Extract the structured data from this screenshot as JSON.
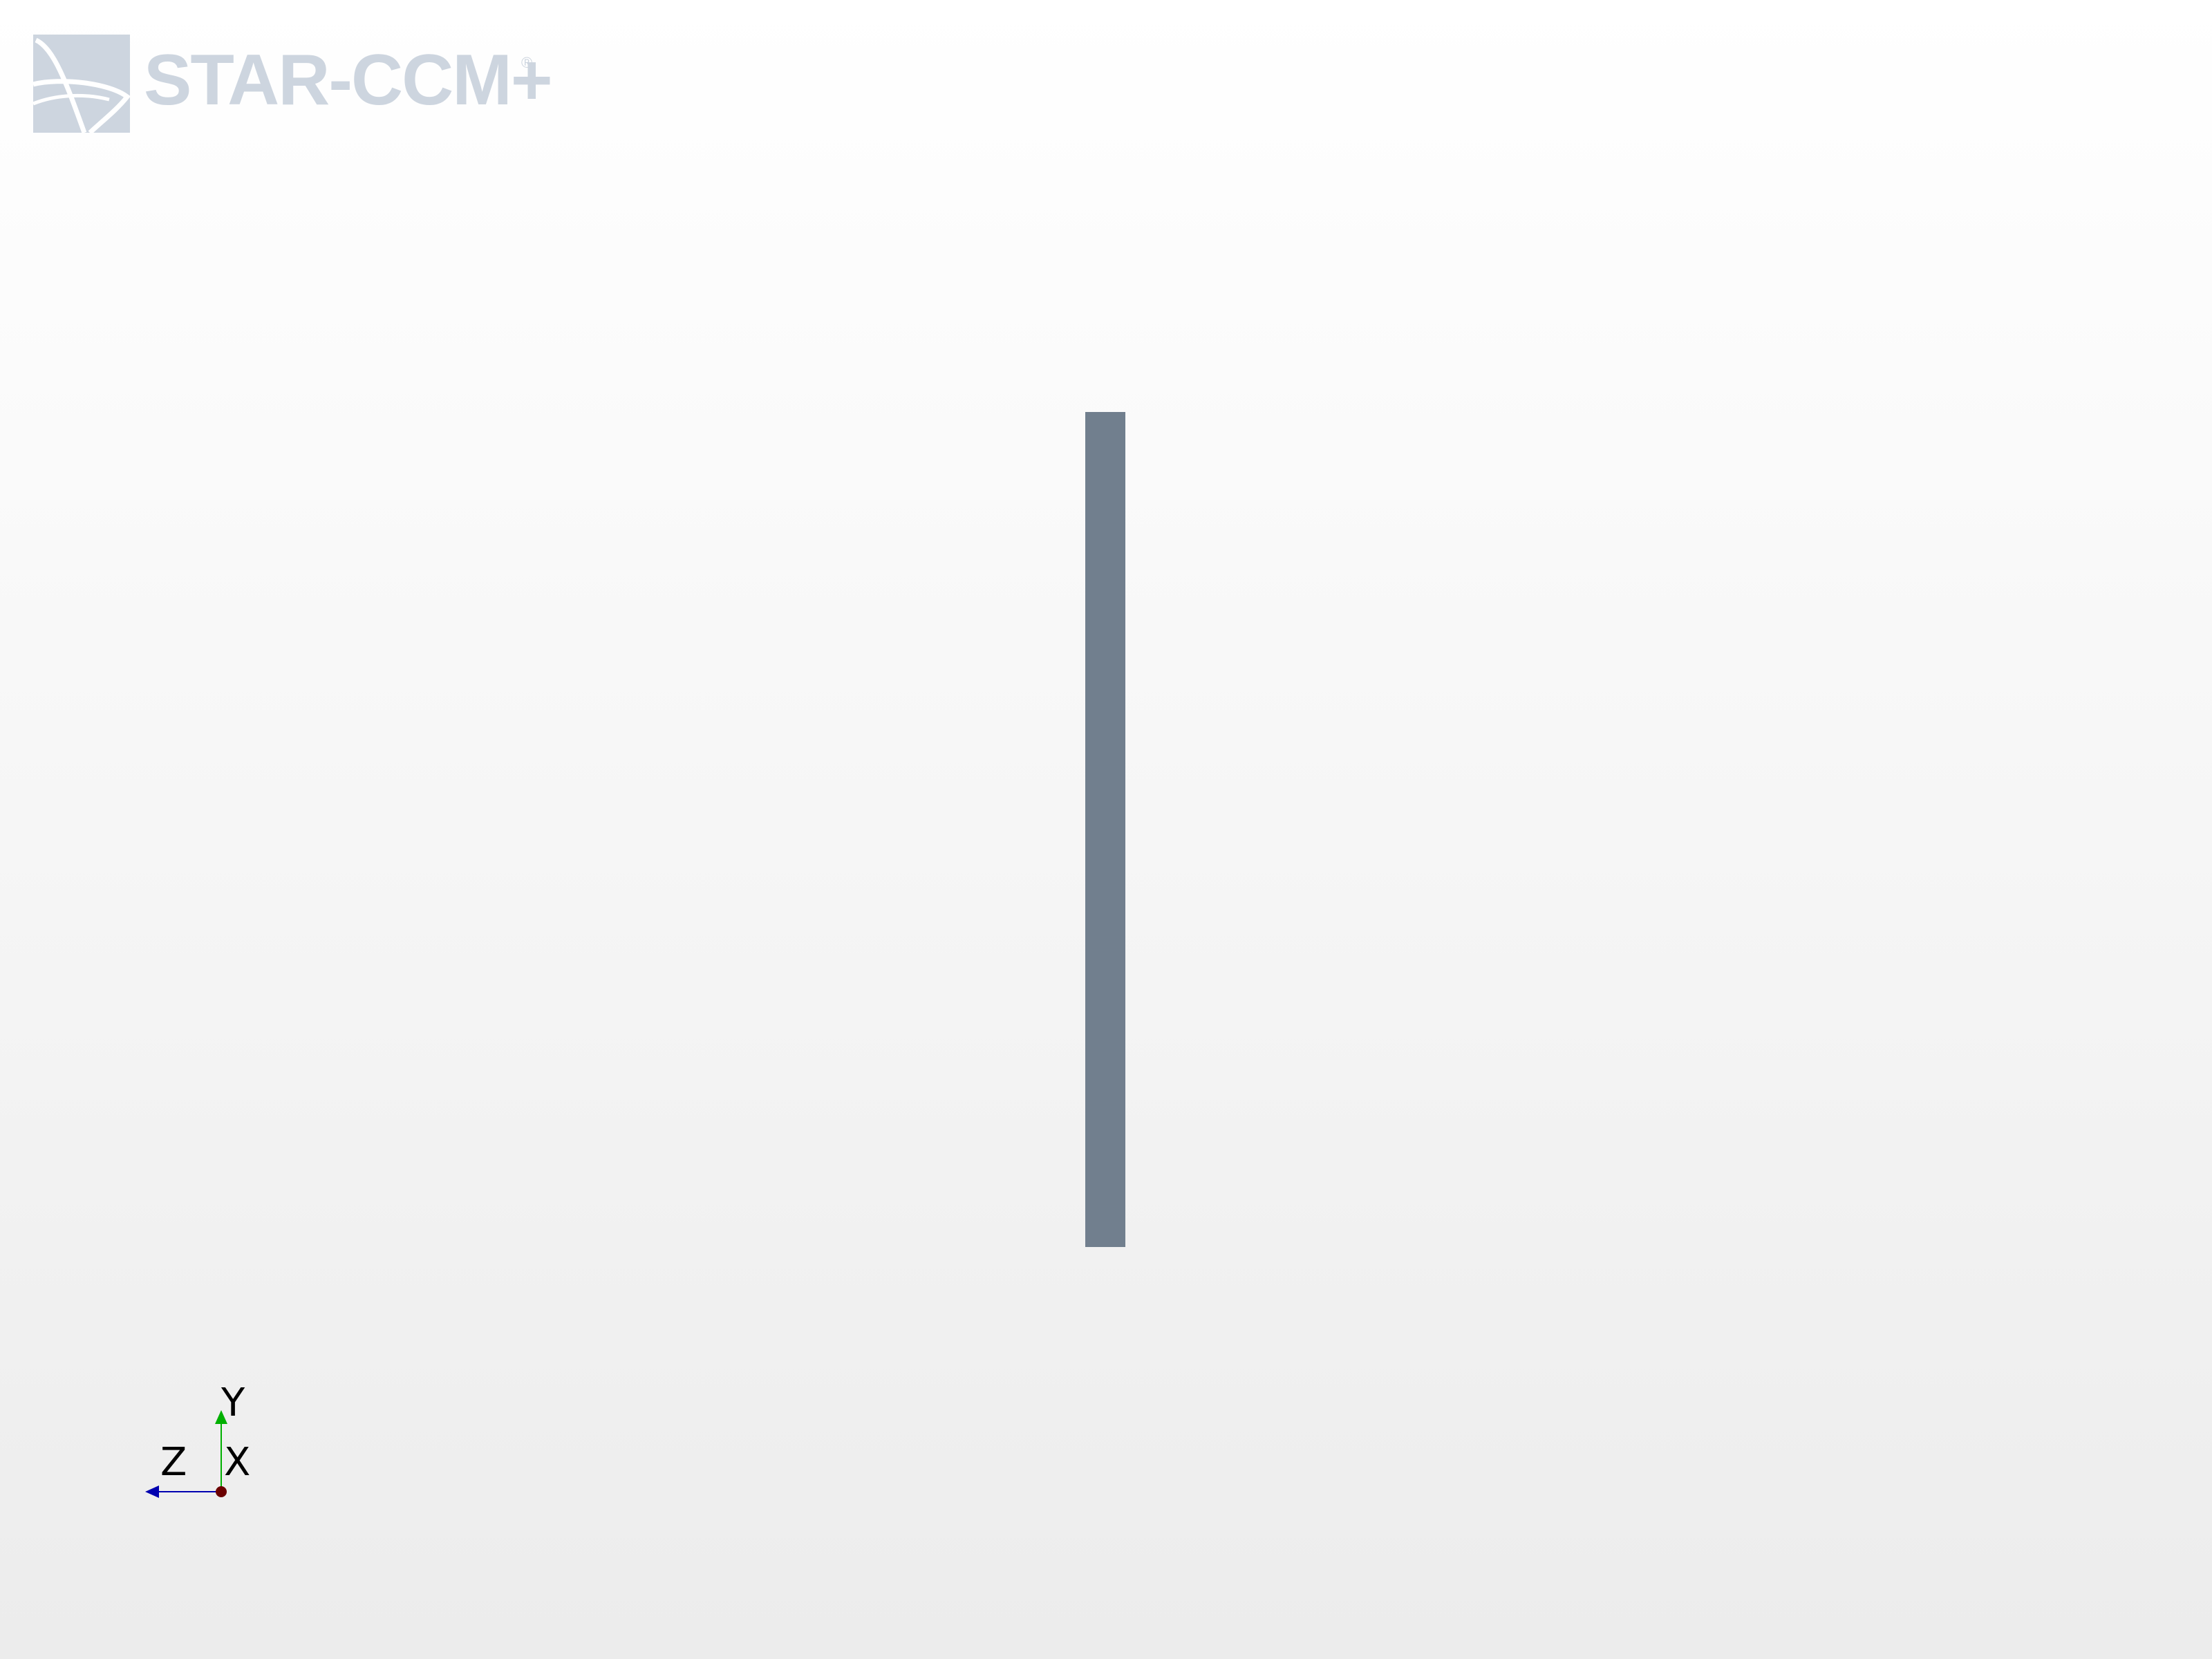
{
  "app": {
    "logo_text": "STAR-CCM+",
    "logo_registered": "®",
    "logo_icon": "star-ccm-logo-icon"
  },
  "scene": {
    "part_color": "#717f8e",
    "background_top": "#ffffff",
    "background_bottom": "#ececec"
  },
  "triad": {
    "x_label": "X",
    "y_label": "Y",
    "z_label": "Z",
    "x_color": "#6b0000",
    "y_color": "#00b000",
    "z_color": "#0000b0"
  }
}
